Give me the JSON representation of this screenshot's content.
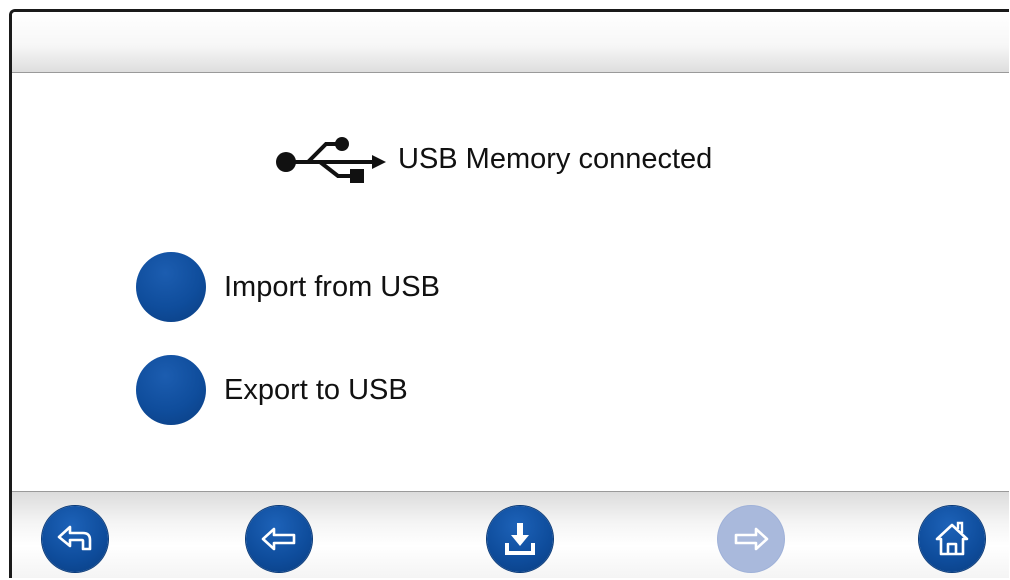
{
  "window": {
    "title": ""
  },
  "usb_status": {
    "icon": "usb-icon",
    "text": "USB Memory connected"
  },
  "options": [
    {
      "label": "Import from USB",
      "selected": false
    },
    {
      "label": "Export to USB",
      "selected": false
    }
  ],
  "toolbar": {
    "buttons": [
      {
        "icon": "return-icon",
        "enabled": true
      },
      {
        "icon": "arrow-left-icon",
        "enabled": true
      },
      {
        "icon": "download-icon",
        "enabled": true
      },
      {
        "icon": "arrow-right-icon",
        "enabled": false
      },
      {
        "icon": "home-icon",
        "enabled": true
      }
    ]
  },
  "colors": {
    "accent": "#0f4d9c",
    "disabled": "#a9b9dc",
    "frame": "#1a1a1a"
  }
}
